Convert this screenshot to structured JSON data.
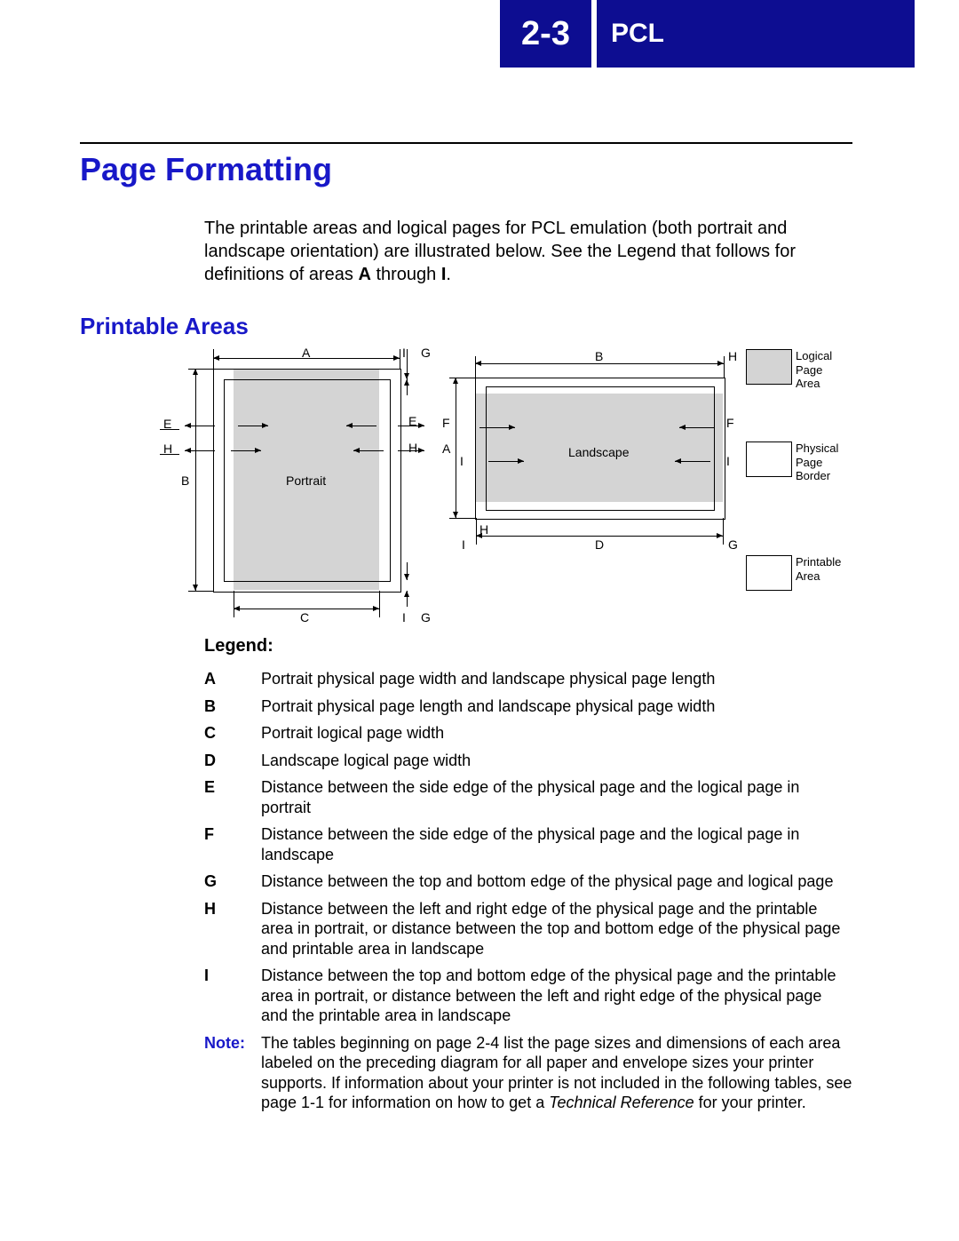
{
  "header": {
    "page_number": "2-3",
    "label": "PCL"
  },
  "title": "Page Formatting",
  "intro": {
    "line1": "The printable areas and logical pages for PCL emulation (both portrait and landscape orientation) are illustrated below. See the Legend that follows for definitions of areas ",
    "bold_a": "A",
    "mid": " through ",
    "bold_i": "I",
    "end": "."
  },
  "subhead": "Printable Areas",
  "diagram": {
    "portrait": "Portrait",
    "landscape": "Landscape",
    "A": "A",
    "B": "B",
    "C": "C",
    "D": "D",
    "E": "E",
    "F": "F",
    "G": "G",
    "H": "H",
    "I": "I",
    "legend_logical": "Logical\nPage\nArea",
    "legend_physical": "Physical\nPage\nBorder",
    "legend_printable": "Printable\nArea"
  },
  "legend_title": "Legend:",
  "legend": [
    {
      "k": "A",
      "v": "Portrait physical page width and landscape physical page length"
    },
    {
      "k": "B",
      "v": "Portrait physical page length and landscape physical page width"
    },
    {
      "k": "C",
      "v": "Portrait logical page width"
    },
    {
      "k": "D",
      "v": "Landscape logical page width"
    },
    {
      "k": "E",
      "v": "Distance between the side edge of the physical page and the logical page in portrait"
    },
    {
      "k": "F",
      "v": "Distance between the side edge of the physical page and the logical page in landscape"
    },
    {
      "k": "G",
      "v": "Distance between the top and bottom edge of the physical page and logical page"
    },
    {
      "k": "H",
      "v": "Distance between the left and right edge of the physical page and the printable area in portrait, or distance between the top and bottom edge of the physical page and printable area in landscape"
    },
    {
      "k": "I",
      "v": "Distance between the top and bottom edge of the physical page and the printable area in portrait, or distance between the left and right edge of the physical page and the printable area in landscape"
    }
  ],
  "note": {
    "label": "Note:",
    "text1": "The tables beginning on page 2-4 list the page sizes and dimensions of each area labeled on the preceding diagram for all paper and envelope sizes your printer supports. If information about your printer is not included in the following tables, see page 1-1 for information on how to get a ",
    "italic": "Technical Reference",
    "text2": " for your printer."
  }
}
